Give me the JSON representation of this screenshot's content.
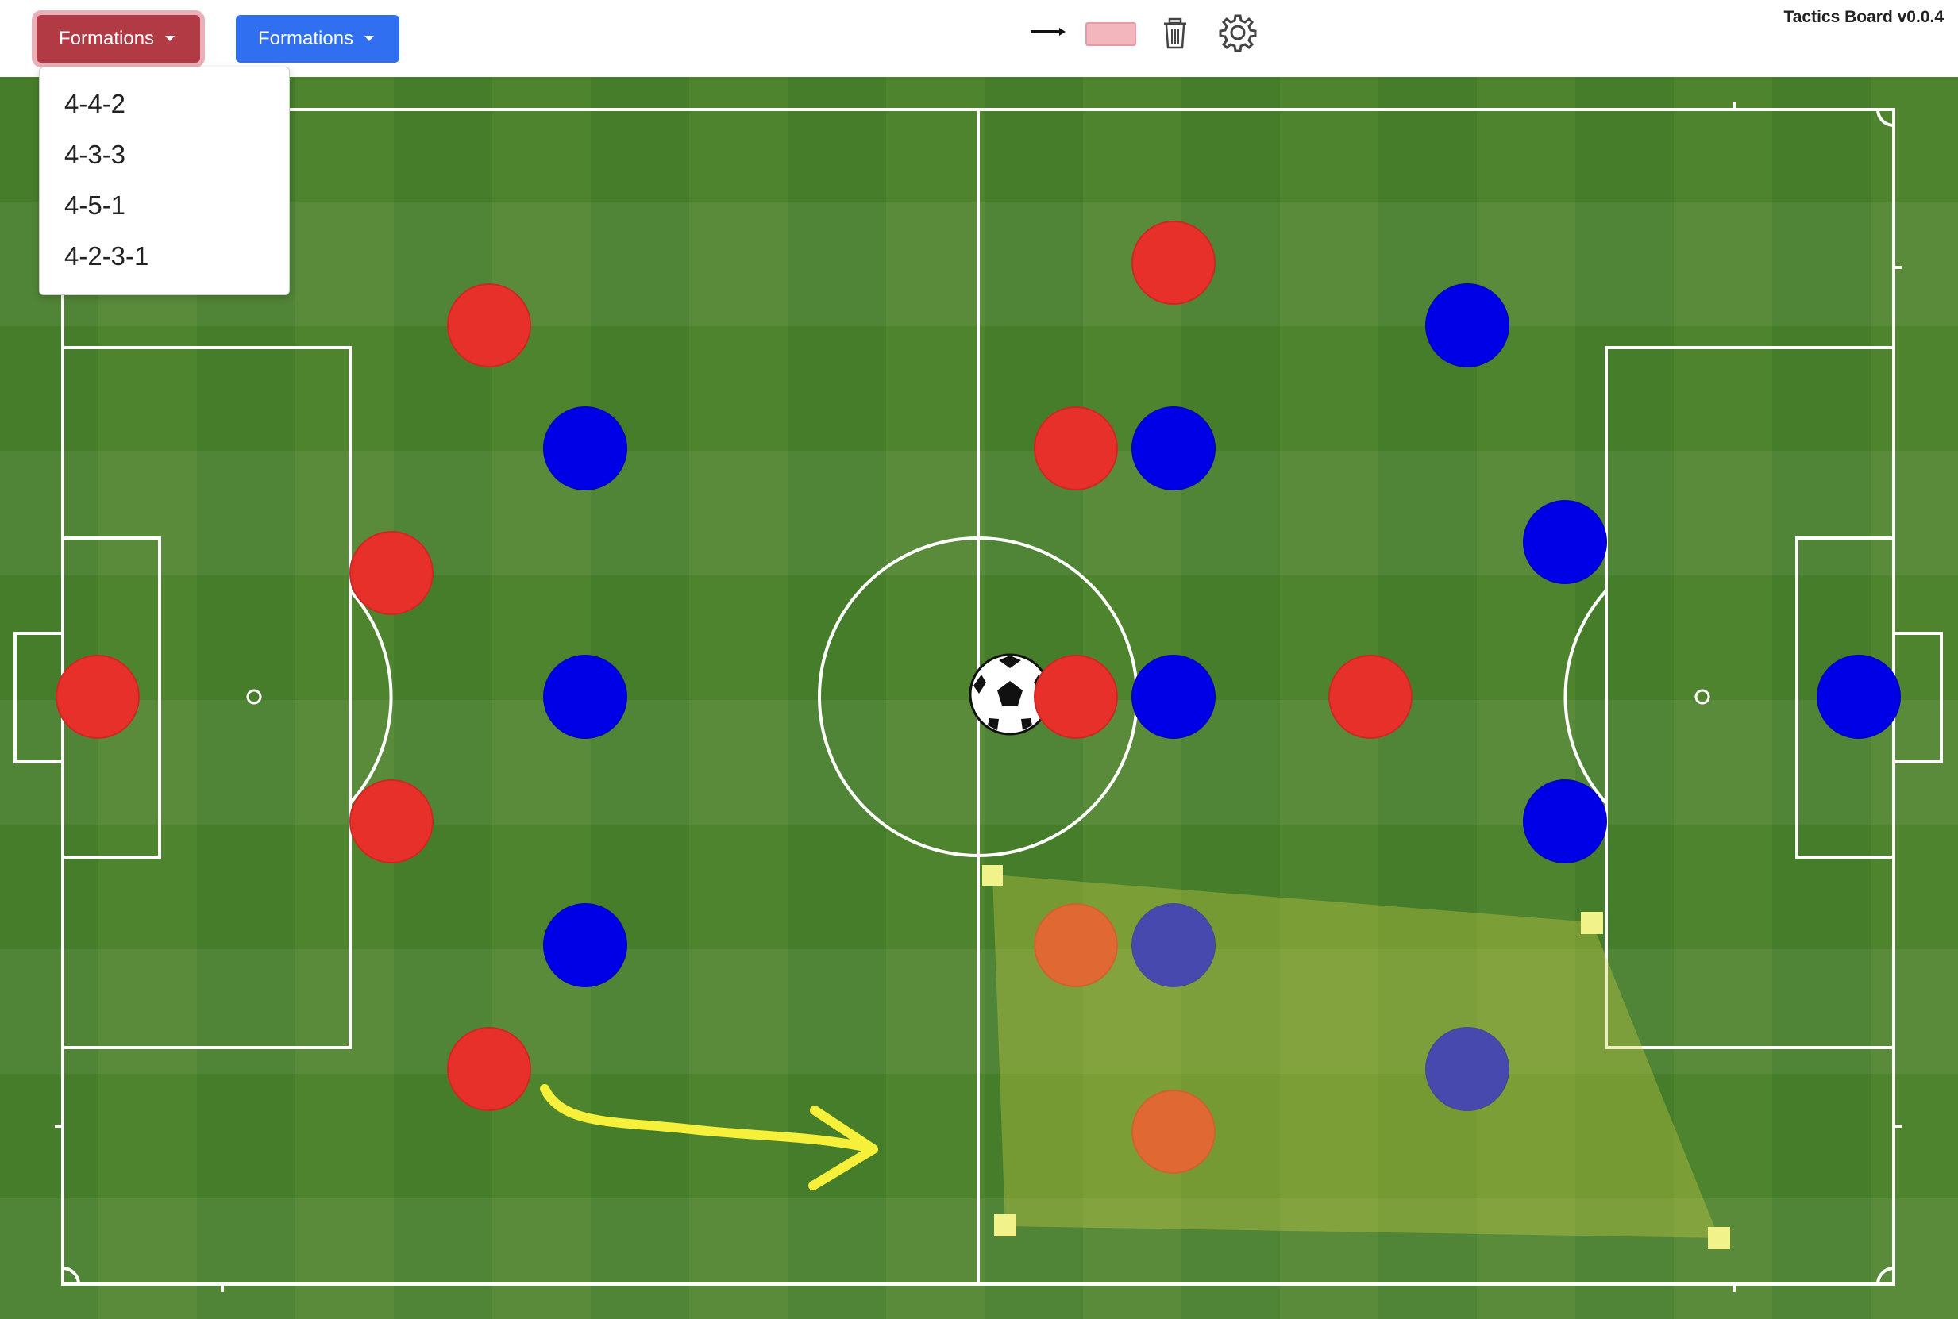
{
  "app": {
    "version_label": "Tactics Board v0.0.4"
  },
  "toolbar": {
    "formations_red_label": "Formations",
    "formations_blue_label": "Formations",
    "tools": [
      "arrow-tool",
      "zone-tool",
      "trash",
      "settings"
    ]
  },
  "formations_menu": {
    "items": [
      {
        "label": "4-4-2"
      },
      {
        "label": "4-3-3"
      },
      {
        "label": "4-5-1"
      },
      {
        "label": "4-2-3-1"
      }
    ]
  },
  "colors": {
    "red_team": "#e8302a",
    "blue_team": "#0000e6",
    "red_button": "#b13a45",
    "blue_button": "#2f6ff0",
    "pitch_dark": "#467d2a",
    "pitch_light": "#588a33",
    "lines": "#ffffff",
    "annotation": "#f2f25a"
  }
}
